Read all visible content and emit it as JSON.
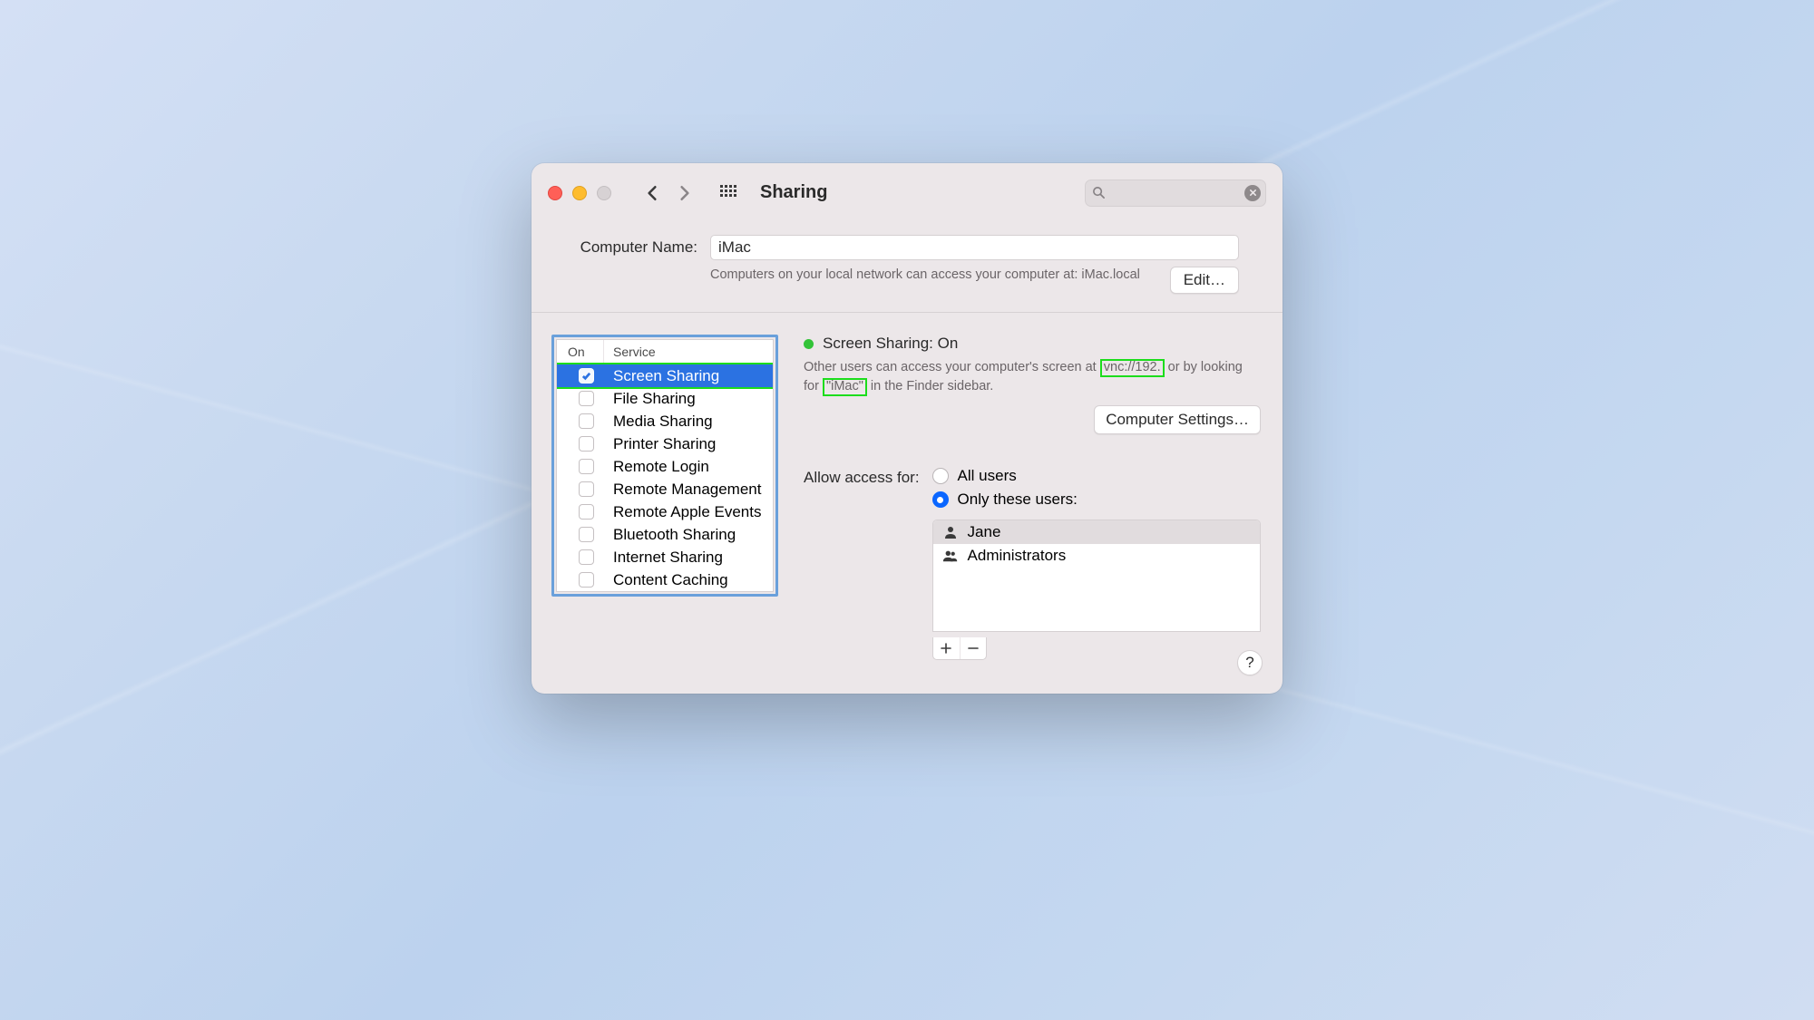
{
  "toolbar": {
    "title": "Sharing",
    "search_placeholder": ""
  },
  "computer_name": {
    "label": "Computer Name:",
    "value": "iMac",
    "description": "Computers on your local network can access your computer at: iMac.local",
    "edit_button": "Edit…"
  },
  "services": {
    "header_on": "On",
    "header_service": "Service",
    "items": [
      {
        "label": "Screen Sharing",
        "on": true,
        "selected": true
      },
      {
        "label": "File Sharing",
        "on": false,
        "selected": false
      },
      {
        "label": "Media Sharing",
        "on": false,
        "selected": false
      },
      {
        "label": "Printer Sharing",
        "on": false,
        "selected": false
      },
      {
        "label": "Remote Login",
        "on": false,
        "selected": false
      },
      {
        "label": "Remote Management",
        "on": false,
        "selected": false
      },
      {
        "label": "Remote Apple Events",
        "on": false,
        "selected": false
      },
      {
        "label": "Bluetooth Sharing",
        "on": false,
        "selected": false
      },
      {
        "label": "Internet Sharing",
        "on": false,
        "selected": false
      },
      {
        "label": "Content Caching",
        "on": false,
        "selected": false
      }
    ]
  },
  "detail": {
    "status_label": "Screen Sharing: On",
    "access_desc_pre": "Other users can access your computer's screen at ",
    "access_desc_hl1": "vnc://192.",
    "access_desc_mid": " or by looking for ",
    "access_desc_hl2": "\"iMac\"",
    "access_desc_post": " in the Finder sidebar.",
    "settings_button": "Computer Settings…",
    "allow_label": "Allow access for:",
    "radio_all": "All users",
    "radio_only": "Only these users:",
    "radio_selected": "only",
    "users": [
      {
        "name": "Jane",
        "type": "user",
        "selected": true
      },
      {
        "name": "Administrators",
        "type": "group",
        "selected": false
      }
    ]
  },
  "help_label": "?"
}
